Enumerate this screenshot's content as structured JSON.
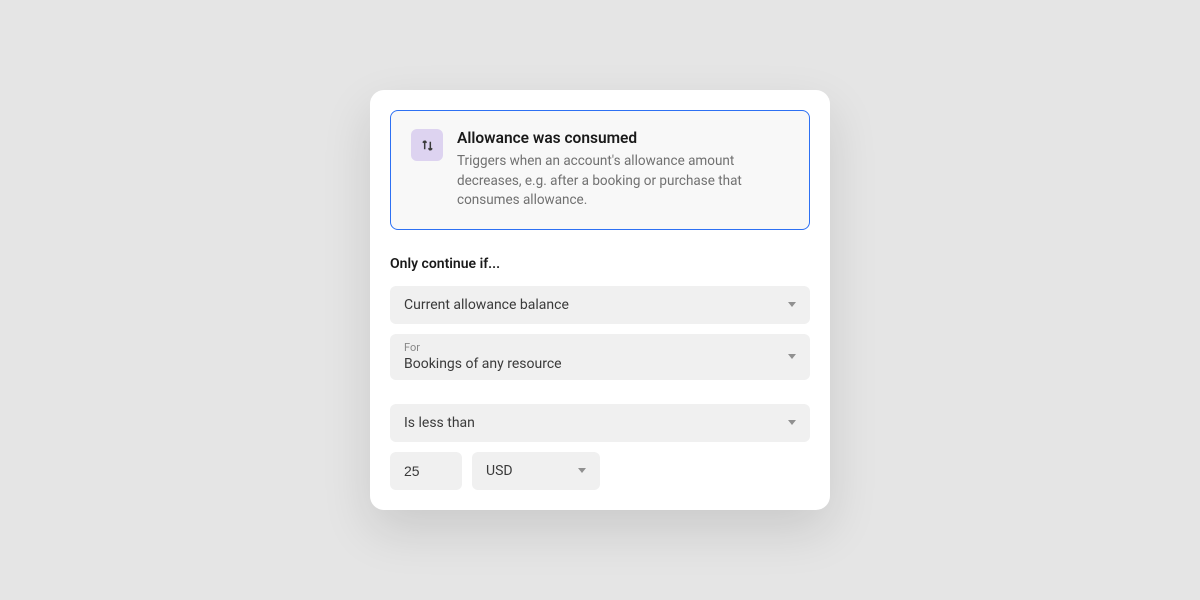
{
  "trigger": {
    "title": "Allowance was consumed",
    "description": "Triggers when an account's allowance amount decreases, e.g. after a booking or purchase that consumes allowance."
  },
  "section_label": "Only continue if...",
  "condition": {
    "field": "Current allowance balance",
    "for_label": "For",
    "for_value": "Bookings of any resource",
    "operator": "Is less than",
    "amount": "25",
    "currency": "USD"
  }
}
